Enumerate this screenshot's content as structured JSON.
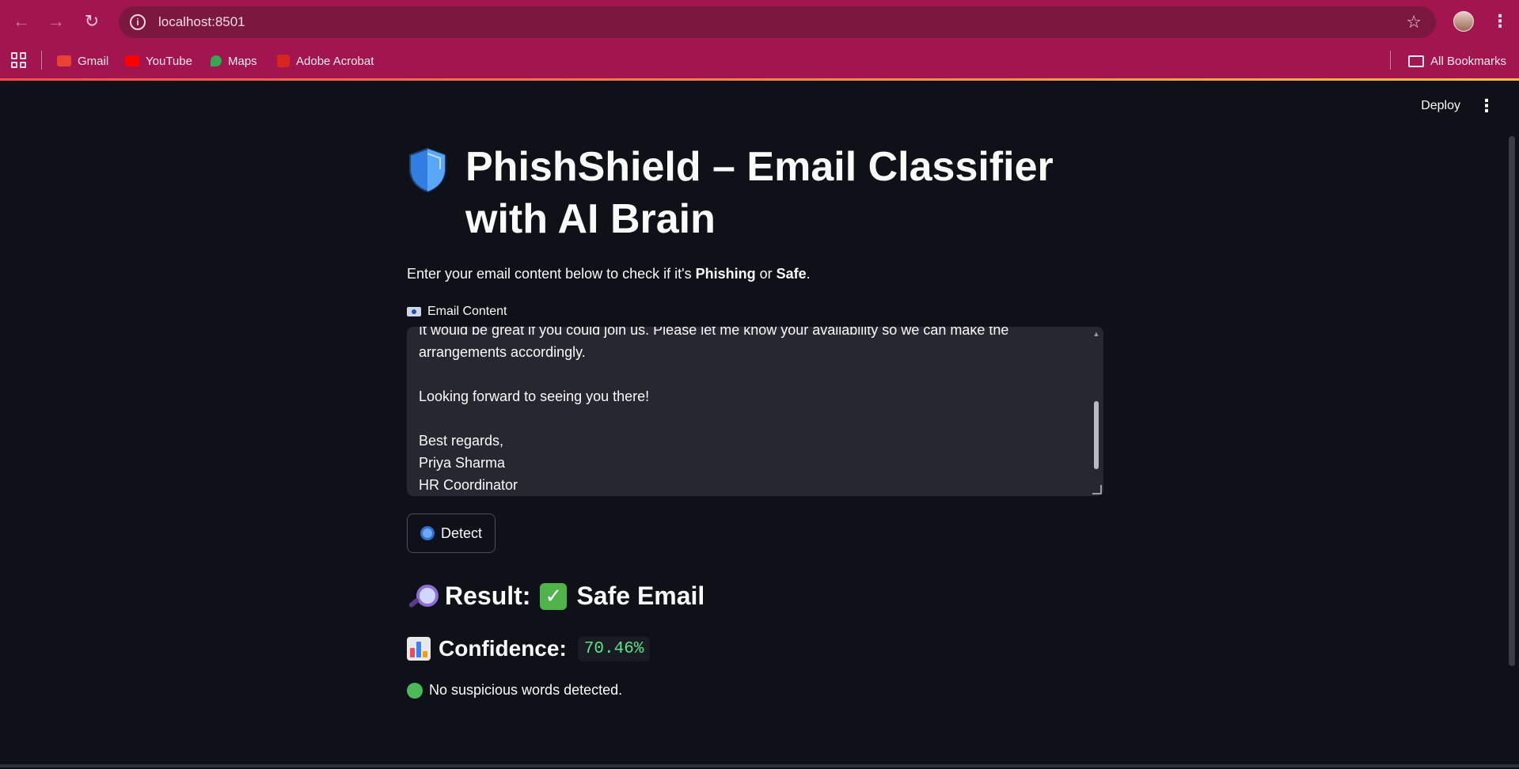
{
  "browser": {
    "url": "localhost:8501",
    "bookmarks": [
      {
        "label": "Gmail",
        "color": "#ea4335"
      },
      {
        "label": "YouTube",
        "color": "#ff0000"
      },
      {
        "label": "Maps",
        "color": "#34a853"
      },
      {
        "label": "Adobe Acrobat",
        "color": "#d7261f"
      }
    ],
    "all_bookmarks_label": "All Bookmarks"
  },
  "header": {
    "deploy_label": "Deploy"
  },
  "main": {
    "title": "PhishShield – Email Classifier with AI Brain",
    "intro_prefix": "Enter your email content below to check if it's ",
    "intro_phishing": "Phishing",
    "intro_or": " or ",
    "intro_safe": "Safe",
    "intro_suffix": ".",
    "field_label": "Email Content",
    "email_text": "It would be great if you could join us. Please let me know your availability so we can make the\narrangements accordingly.\n\nLooking forward to seeing you there!\n\nBest regards,\nPriya Sharma\nHR Coordinator",
    "detect_label": "Detect",
    "result_label": "Result:",
    "result_value": "Safe Email",
    "confidence_label": "Confidence:",
    "confidence_value": "70.46%",
    "note": "No suspicious words detected."
  },
  "colors": {
    "browser_accent": "#a3154e",
    "app_background": "#0e1117",
    "safe_green": "#4dba5a",
    "confidence_green": "#5ce488"
  }
}
